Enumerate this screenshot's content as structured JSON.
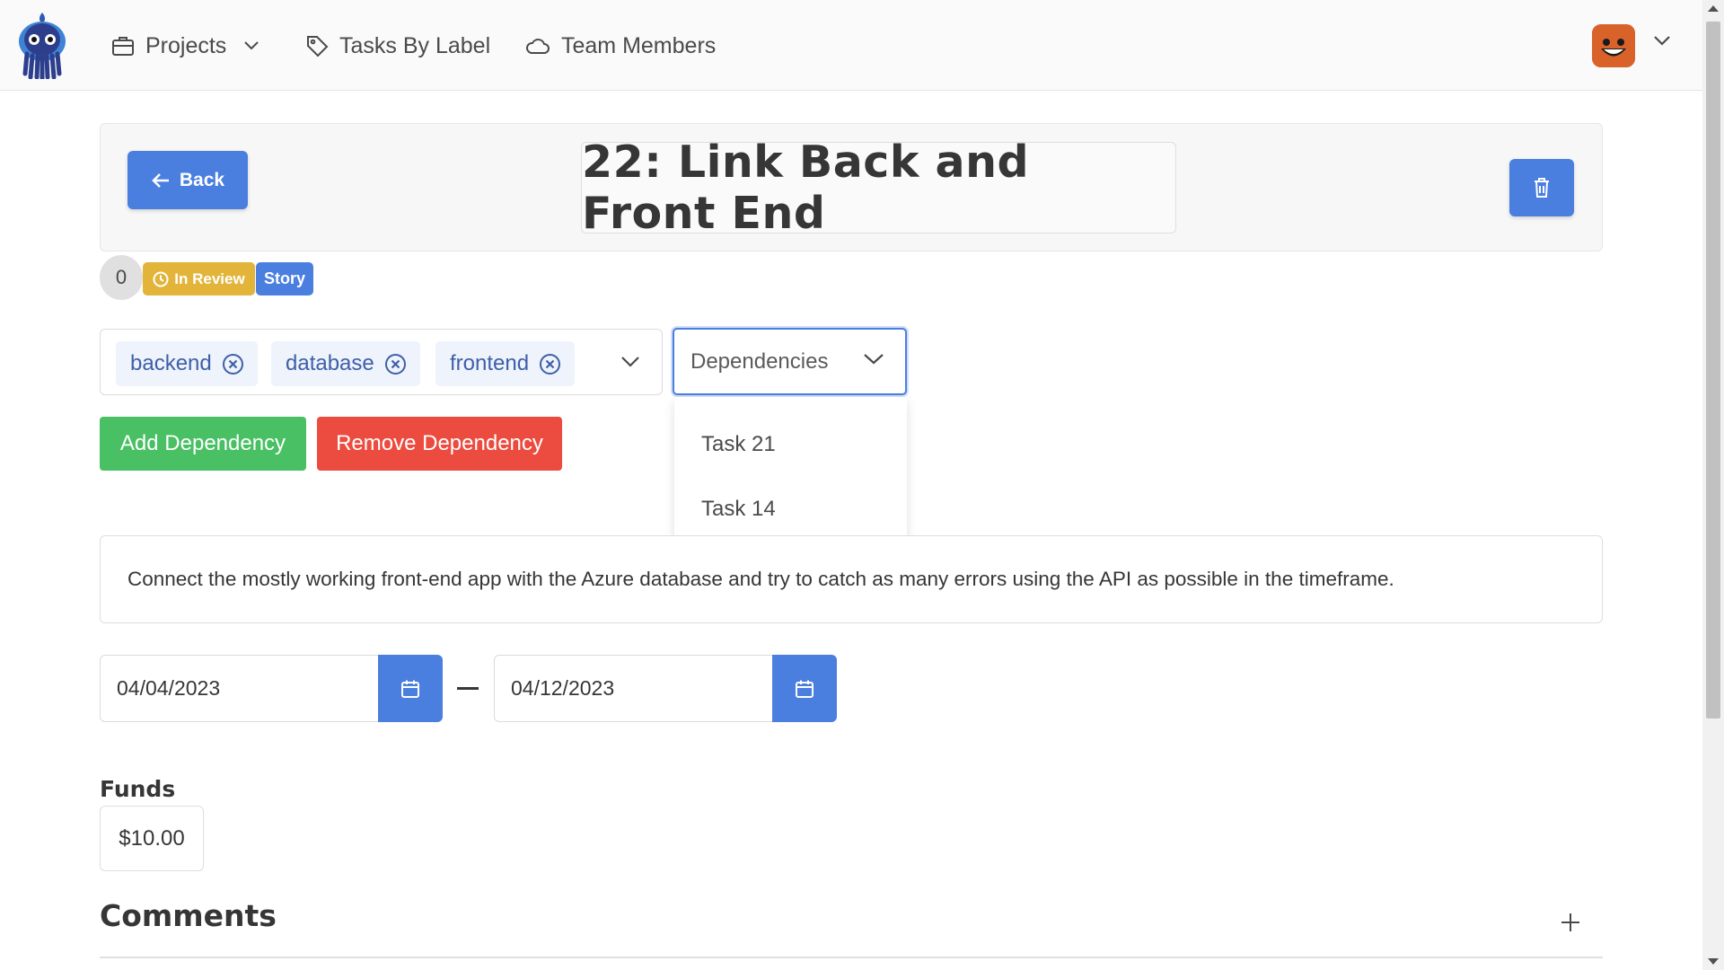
{
  "nav": {
    "projects": "Projects",
    "tasks_by_label": "Tasks By Label",
    "team_members": "Team Members"
  },
  "header": {
    "back_label": "Back",
    "title": "22: Link Back and Front End"
  },
  "task": {
    "count": "0",
    "status": "In Review",
    "type": "Story"
  },
  "labels": [
    "backend",
    "database",
    "frontend"
  ],
  "dependencies": {
    "placeholder": "Dependencies",
    "options": [
      "Task 21",
      "Task 14"
    ]
  },
  "buttons": {
    "add_dependency": "Add Dependency",
    "remove_dependency": "Remove Dependency"
  },
  "description": "Connect the mostly working front-end app with the Azure database and try to catch as many errors using the API as possible in the timeframe.",
  "dates": {
    "start": "04/04/2023",
    "end": "04/12/2023"
  },
  "funds": {
    "label": "Funds",
    "value": "$10.00"
  },
  "comments": {
    "title": "Comments"
  },
  "colors": {
    "primary": "#4a7fe0",
    "success": "#48c063",
    "danger": "#ec4b3f",
    "warning": "#e2b43a"
  }
}
